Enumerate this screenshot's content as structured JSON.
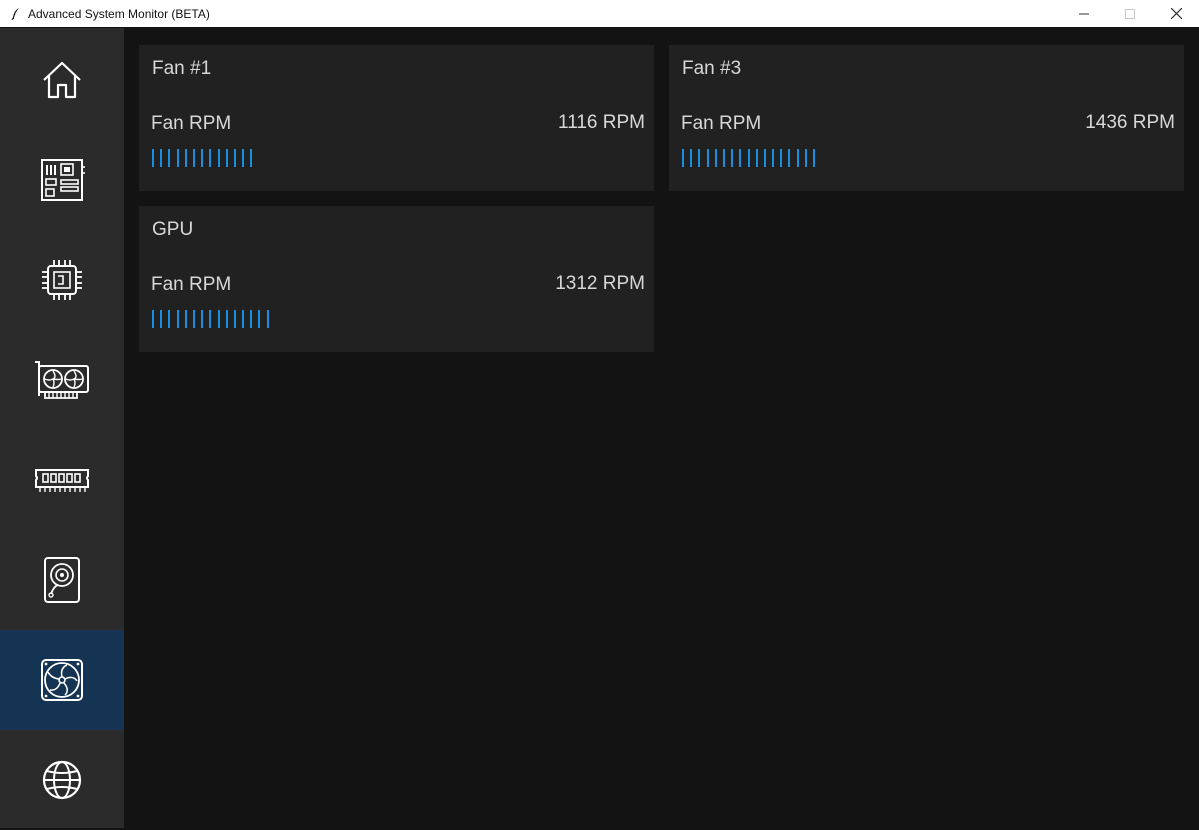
{
  "window": {
    "title": "Advanced System Monitor (BETA)"
  },
  "sidebar": {
    "items": [
      {
        "name": "home",
        "icon": "home-icon",
        "active": false
      },
      {
        "name": "motherboard",
        "icon": "motherboard-icon",
        "active": false
      },
      {
        "name": "cpu",
        "icon": "cpu-icon",
        "active": false
      },
      {
        "name": "gpu",
        "icon": "graphics-card-icon",
        "active": false
      },
      {
        "name": "memory",
        "icon": "ram-icon",
        "active": false
      },
      {
        "name": "storage",
        "icon": "hard-drive-icon",
        "active": false
      },
      {
        "name": "fans",
        "icon": "fan-icon",
        "active": true
      },
      {
        "name": "network",
        "icon": "globe-icon",
        "active": false
      }
    ],
    "active_color": "#153352"
  },
  "cards": [
    {
      "title": "Fan #1",
      "metric_label": "Fan RPM",
      "value": "1116 RPM",
      "ticks": 13
    },
    {
      "title": "Fan #3",
      "metric_label": "Fan RPM",
      "value": "1436 RPM",
      "ticks": 17
    },
    {
      "title": "GPU",
      "metric_label": "Fan RPM",
      "value": "1312 RPM",
      "ticks": 15
    }
  ],
  "colors": {
    "accent": "#1a8fe0",
    "card_bg": "#212121",
    "main_bg": "#131313",
    "sidebar_bg": "#2b2b2b"
  }
}
